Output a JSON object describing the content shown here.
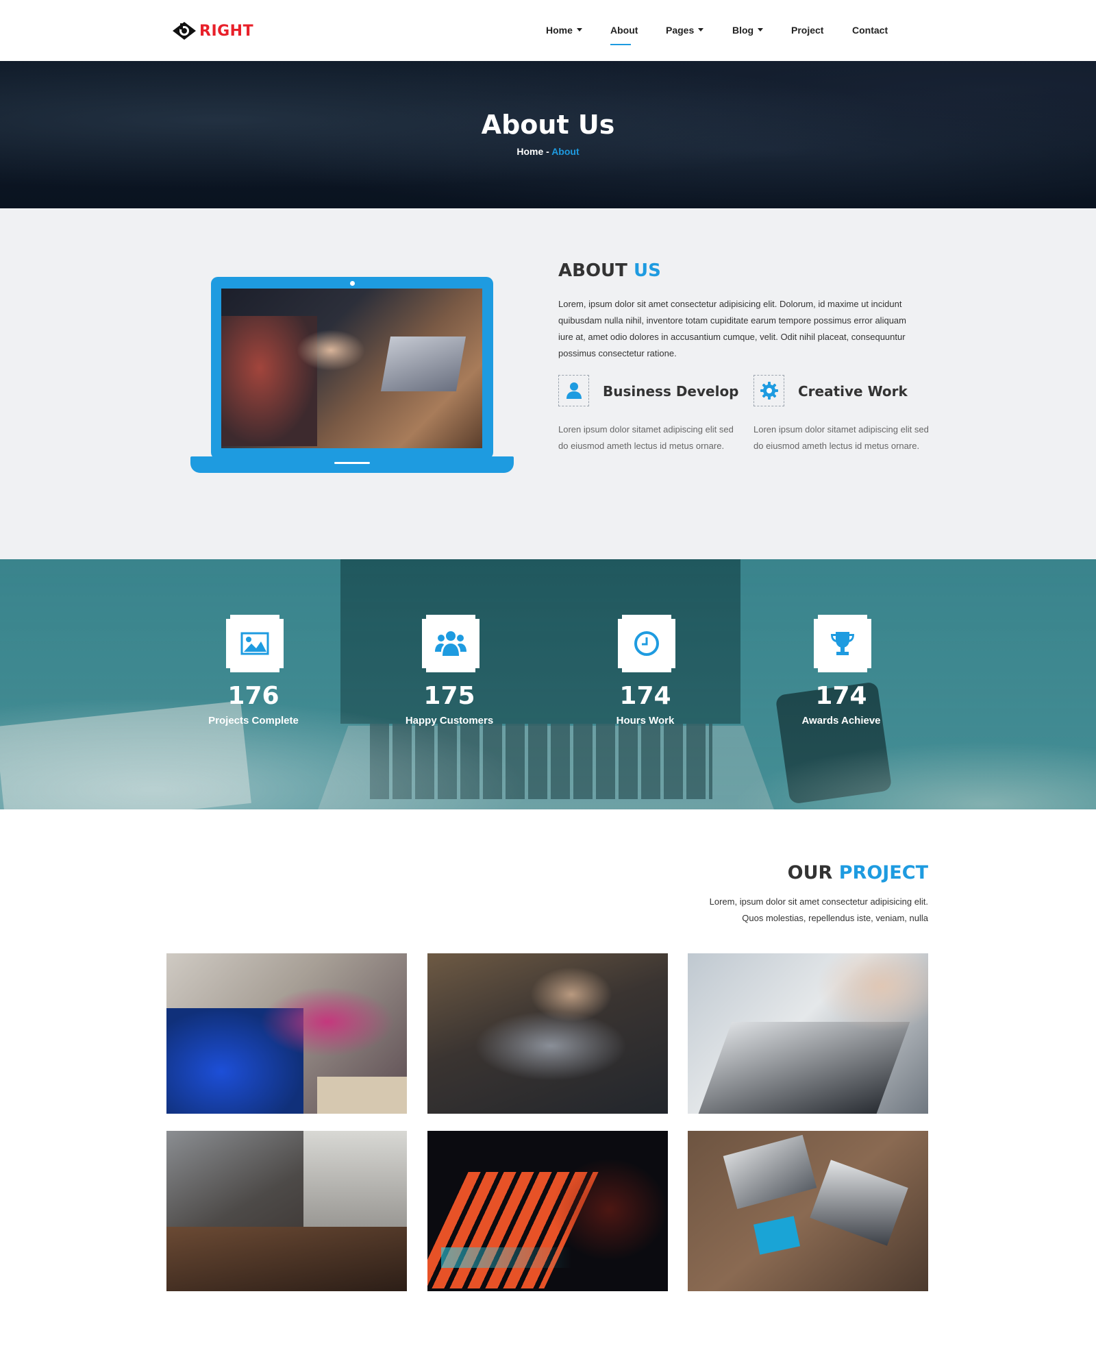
{
  "brand": {
    "logo_text": "RIGHT",
    "accent": "#1e9be0",
    "logo_color": "#e8202a"
  },
  "nav": {
    "items": [
      {
        "label": "Home",
        "dropdown": true
      },
      {
        "label": "About",
        "dropdown": false,
        "active": true
      },
      {
        "label": "Pages",
        "dropdown": true
      },
      {
        "label": "Blog",
        "dropdown": true
      },
      {
        "label": "Project",
        "dropdown": false
      },
      {
        "label": "Contact",
        "dropdown": false
      }
    ]
  },
  "hero": {
    "title": "About Us",
    "breadcrumb": {
      "home": "Home",
      "separator": " - ",
      "current": "About"
    }
  },
  "about": {
    "heading_main": "ABOUT ",
    "heading_accent": "US",
    "text": "Lorem, ipsum dolor sit amet consectetur adipisicing elit. Dolorum, id maxime ut incidunt quibusdam nulla nihil, inventore totam cupiditate earum tempore possimus error aliquam iure at, amet odio dolores in accusantium cumque, velit. Odit nihil placeat, consequuntur possimus consectetur ratione.",
    "features": [
      {
        "icon": "user-icon",
        "title": "Business Develop",
        "text": "Loren ipsum dolor sitamet adipiscing elit sed do eiusmod ameth lectus id metus ornare."
      },
      {
        "icon": "gear-icon",
        "title": "Creative Work",
        "text": "Loren ipsum dolor sitamet adipiscing elit sed do eiusmod ameth lectus id metus ornare."
      }
    ]
  },
  "stats": [
    {
      "icon": "image-icon",
      "value": "176",
      "label": "Projects Complete"
    },
    {
      "icon": "users-icon",
      "value": "175",
      "label": "Happy Customers"
    },
    {
      "icon": "clock-icon",
      "value": "174",
      "label": "Hours Work"
    },
    {
      "icon": "trophy-icon",
      "value": "174",
      "label": "Awards Achieve"
    }
  ],
  "projects": {
    "heading_main": "OUR ",
    "heading_accent": "PROJECT",
    "text_line1": "Lorem, ipsum dolor sit amet consectetur adipisicing elit.",
    "text_line2": "Quos molestias, repellendus iste, veniam, nulla"
  }
}
